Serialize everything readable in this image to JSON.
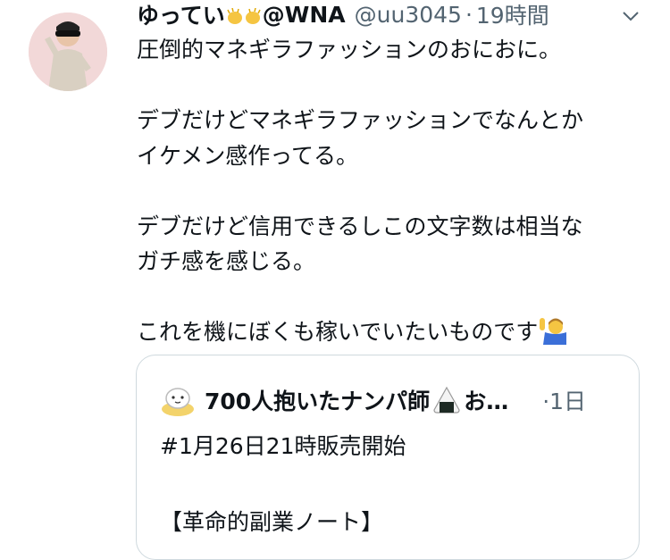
{
  "tweet": {
    "author_name": "ゆってい",
    "author_name_suffix": "@WNA",
    "handle": "@uu3045",
    "separator": "·",
    "time": "19時間",
    "lines": [
      "圧倒的マネギラファッションのおにおに。",
      "デブだけどマネギラファッションでなんとか",
      "イケメン感作ってる。",
      "デブだけど信用できるしこの文字数は相当な",
      "ガチ感を感じる。",
      "これを機にぼくも稼いでいたいものです"
    ],
    "icons": {
      "name_emoji": "waving-hands-emoji",
      "menu": "chevron-down-icon",
      "line_end_emoji": "person-raising-hand-emoji"
    }
  },
  "quoted_tweet": {
    "author_name": "700人抱いたナンパ師",
    "author_name_tail": "お…",
    "separator": "·",
    "time": "1日",
    "lines": [
      "#1月26日21時販売開始",
      "【革命的副業ノート】"
    ],
    "icons": {
      "avatar": "cartoon-avatar",
      "name_emoji": "rice-ball-emoji"
    }
  },
  "colors": {
    "text": "#0f1419",
    "secondary": "#536471",
    "border": "#cfd9de"
  }
}
